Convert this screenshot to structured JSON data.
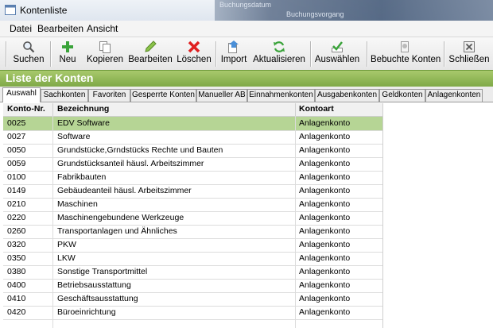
{
  "window": {
    "title": "Kontenliste",
    "bg_title_1": "Buchungsdatum",
    "bg_title_2": "Buchungsvorgang"
  },
  "menu": [
    "Datei",
    "Bearbeiten",
    "Ansicht"
  ],
  "toolbar": {
    "suchen": "Suchen",
    "neu": "Neu",
    "kopieren": "Kopieren",
    "bearbeiten": "Bearbeiten",
    "loeschen": "Löschen",
    "import": "Import",
    "aktualisieren": "Aktualisieren",
    "auswaehlen": "Auswählen",
    "bebuchte": "Bebuchte Konten",
    "schliessen": "Schließen"
  },
  "list_title": "Liste der Konten",
  "tabs": [
    "Auswahl",
    "Sachkonten",
    "Favoriten",
    "Gesperrte Konten",
    "Manueller AB",
    "Einnahmenkonten",
    "Ausgabenkonten",
    "Geldkonten",
    "Anlagenkonten"
  ],
  "table": {
    "headers": [
      "Konto-Nr.",
      "Bezeichnung",
      "Kontoart"
    ],
    "rows": [
      [
        "0025",
        "EDV Software",
        "Anlagenkonto"
      ],
      [
        "0027",
        "Software",
        "Anlagenkonto"
      ],
      [
        "0050",
        "Grundstücke,Grndstücks Rechte und Bauten",
        "Anlagenkonto"
      ],
      [
        "0059",
        "Grundstücksanteil häusl. Arbeitszimmer",
        "Anlagenkonto"
      ],
      [
        "0100",
        "Fabrikbauten",
        "Anlagenkonto"
      ],
      [
        "0149",
        "Gebäudeanteil häusl. Arbeitszimmer",
        "Anlagenkonto"
      ],
      [
        "0210",
        "Maschinen",
        "Anlagenkonto"
      ],
      [
        "0220",
        "Maschinengebundene Werkzeuge",
        "Anlagenkonto"
      ],
      [
        "0260",
        "Transportanlagen und Ähnliches",
        "Anlagenkonto"
      ],
      [
        "0320",
        "PKW",
        "Anlagenkonto"
      ],
      [
        "0350",
        "LKW",
        "Anlagenkonto"
      ],
      [
        "0380",
        "Sonstige Transportmittel",
        "Anlagenkonto"
      ],
      [
        "0400",
        "Betriebsausstattung",
        "Anlagenkonto"
      ],
      [
        "0410",
        "Geschäftsausstattung",
        "Anlagenkonto"
      ],
      [
        "0420",
        "Büroeinrichtung",
        "Anlagenkonto"
      ]
    ],
    "selected_row": 0
  },
  "colors": {
    "header_green": "#8fb456",
    "selected_row": "#b6d595"
  }
}
